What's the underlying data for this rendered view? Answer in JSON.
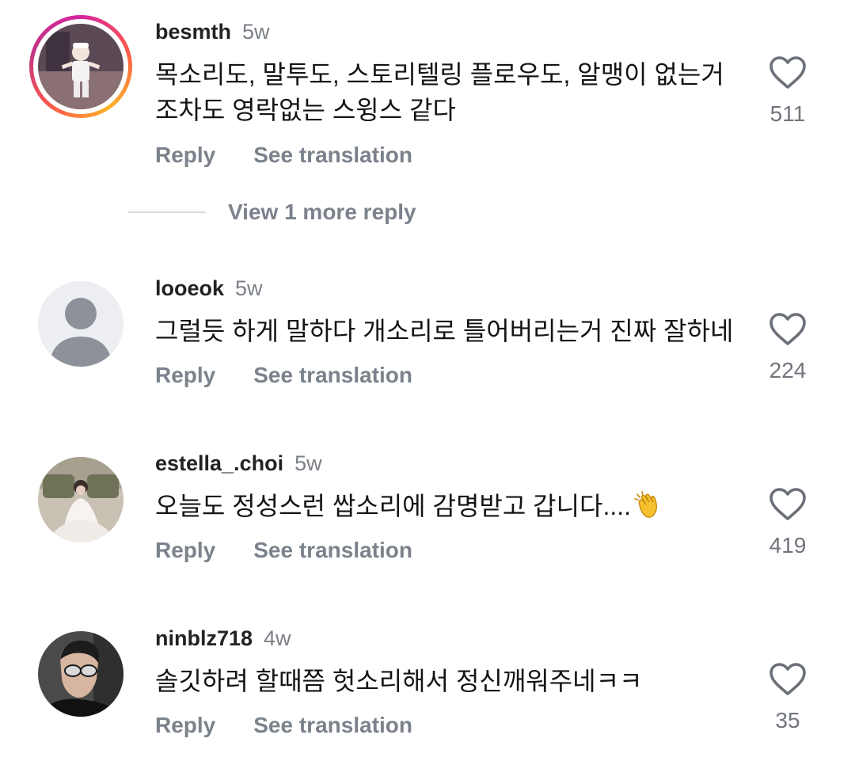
{
  "comments": [
    {
      "username": "besmth",
      "time": "5w",
      "text_lines": [
        "목소리도, 말투도, 스토리텔링 플로우도, 알맹이 없는거",
        "조차도 영락없는 스윙스 같다"
      ],
      "reply_label": "Reply",
      "translate_label": "See translation",
      "likes": "511",
      "has_story_ring": true,
      "view_replies_label": "View 1 more reply"
    },
    {
      "username": "looeok",
      "time": "5w",
      "text_lines": [
        "그럴듯 하게 말하다 개소리로 틀어버리는거 진짜 잘하네"
      ],
      "reply_label": "Reply",
      "translate_label": "See translation",
      "likes": "224"
    },
    {
      "username": "estella_.choi",
      "time": "5w",
      "text_lines": [
        "오늘도 정성스런 쌉소리에 감명받고 갑니다...."
      ],
      "emoji": "clapping-hands",
      "reply_label": "Reply",
      "translate_label": "See translation",
      "likes": "419"
    },
    {
      "username": "ninblz718",
      "time": "4w",
      "text_lines": [
        "솔깃하려 할때쯤 헛소리해서 정신깨워주네ㅋㅋ"
      ],
      "reply_label": "Reply",
      "translate_label": "See translation",
      "likes": "35"
    }
  ],
  "colors": {
    "secondary_text": "#7b828c",
    "heart_outline": "#6b7078",
    "story_ring": "#d6249f"
  }
}
